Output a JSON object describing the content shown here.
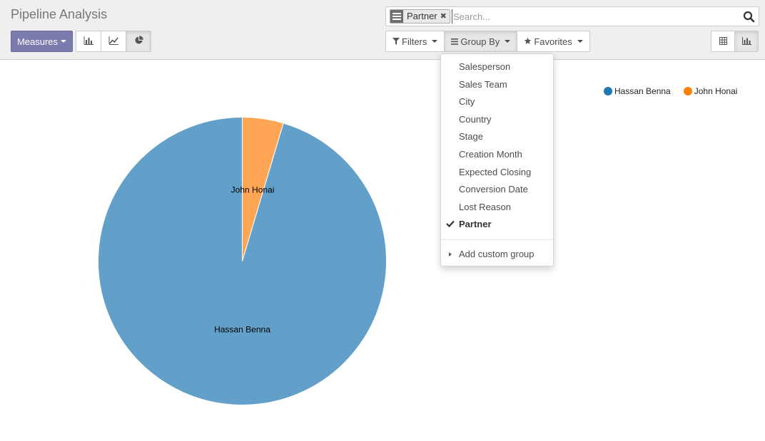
{
  "page": {
    "title": "Pipeline Analysis"
  },
  "search": {
    "facet_icon": "list-icon",
    "facet_value": "Partner",
    "placeholder": "Search..."
  },
  "toolbar": {
    "measures_label": "Measures",
    "modes": [
      {
        "icon": "bar-chart-icon",
        "active": false
      },
      {
        "icon": "line-chart-icon",
        "active": false
      },
      {
        "icon": "pie-chart-icon",
        "active": true
      }
    ],
    "filters_label": "Filters",
    "groupby_label": "Group By",
    "favorites_label": "Favorites",
    "views": [
      {
        "icon": "pivot-table-icon",
        "active": false
      },
      {
        "icon": "graph-view-icon",
        "active": true
      }
    ]
  },
  "groupby_menu": {
    "items": [
      {
        "label": "Salesperson",
        "selected": false
      },
      {
        "label": "Sales Team",
        "selected": false
      },
      {
        "label": "City",
        "selected": false
      },
      {
        "label": "Country",
        "selected": false
      },
      {
        "label": "Stage",
        "selected": false
      },
      {
        "label": "Creation Month",
        "selected": false
      },
      {
        "label": "Expected Closing",
        "selected": false
      },
      {
        "label": "Conversion Date",
        "selected": false
      },
      {
        "label": "Lost Reason",
        "selected": false
      },
      {
        "label": "Partner",
        "selected": true
      }
    ],
    "custom_label": "Add custom group"
  },
  "chart_data": {
    "type": "pie",
    "slices": [
      {
        "label": "Hassan Benna",
        "value": 95.4,
        "color": "#1f77b4"
      },
      {
        "label": "John Honai",
        "value": 4.6,
        "color": "#ff7f0e"
      }
    ],
    "legend": [
      {
        "label": "Hassan Benna",
        "color": "#1f77b4"
      },
      {
        "label": "John Honai",
        "color": "#ff7f0e"
      }
    ],
    "legend_position": "top-right"
  }
}
